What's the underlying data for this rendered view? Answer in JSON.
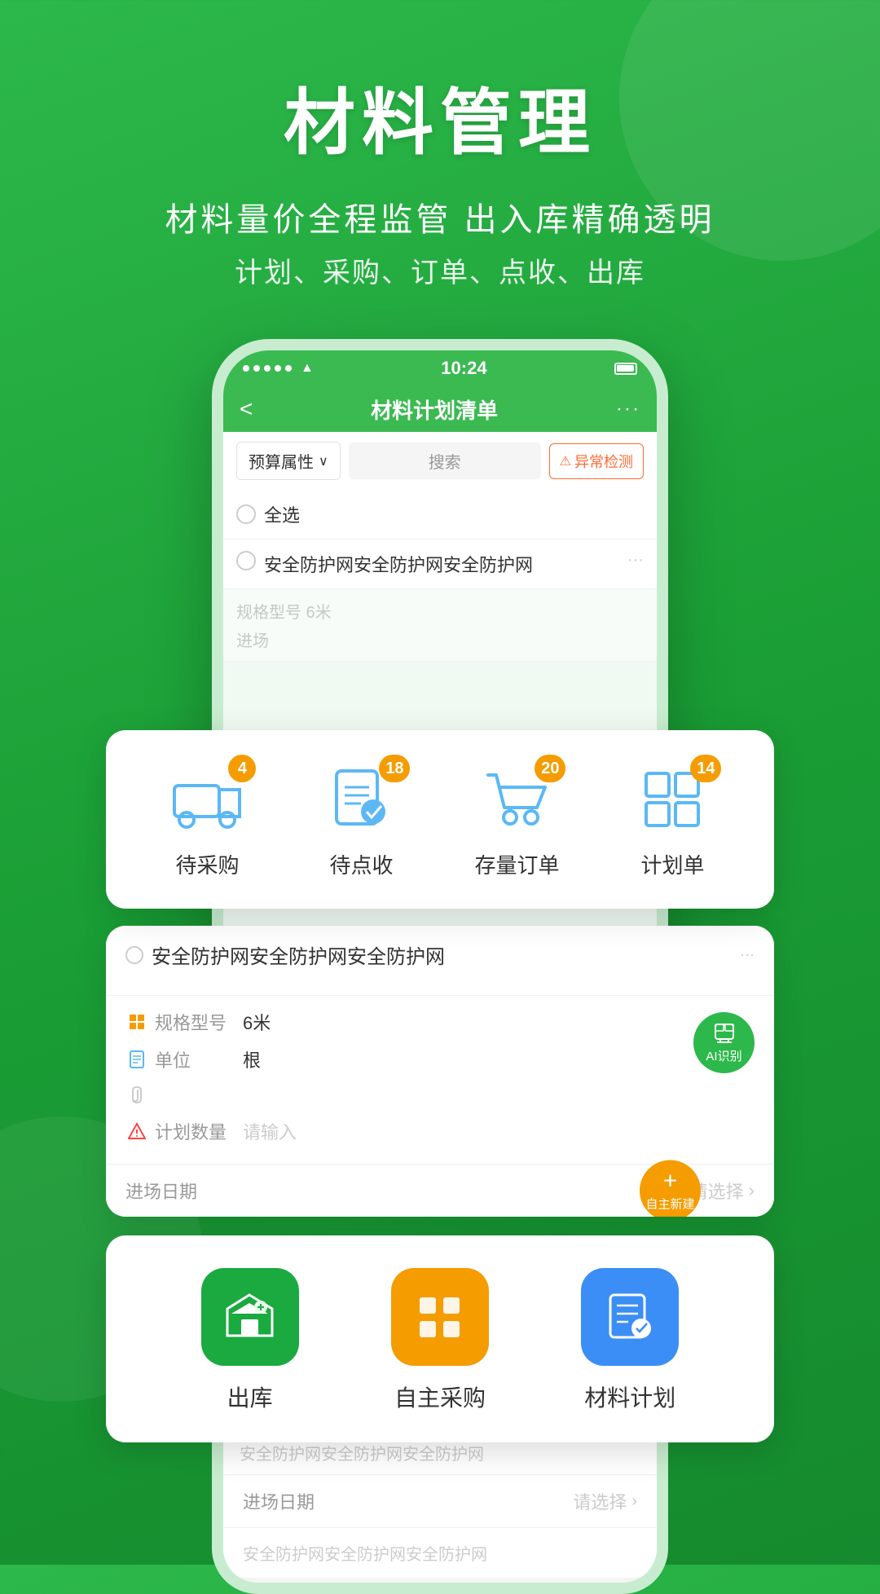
{
  "page": {
    "title": "材料管理",
    "subtitle1": "材料量价全程监管  出入库精确透明",
    "subtitle2": "计划、采购、订单、点收、出库"
  },
  "phone": {
    "status": {
      "time": "10:24",
      "wifi": "wifi",
      "battery": "battery"
    },
    "nav": {
      "back": "<",
      "title": "材料计划清单",
      "more": "···"
    },
    "filter": {
      "select_label": "预算属性",
      "search_placeholder": "搜索",
      "abnormal_label": "异常检测"
    },
    "list": {
      "select_all_label": "全选",
      "items": [
        {
          "name": "安全防护网安全防护网安全防护网"
        },
        {
          "name": "安全防护网安全防护网安全防护网"
        }
      ]
    },
    "detail_fields": [
      {
        "icon": "size-icon",
        "label": "规格型号",
        "value": "6米"
      },
      {
        "icon": "unit-icon",
        "label": "单位",
        "value": "根"
      },
      {
        "icon": "clip-icon",
        "label": "",
        "value": ""
      },
      {
        "icon": "warn-icon",
        "label": "计划数量",
        "placeholder": "请输入"
      }
    ],
    "date_row": {
      "label": "进场日期",
      "placeholder": "请选择"
    }
  },
  "quick_actions": [
    {
      "label": "待采购",
      "badge": "4"
    },
    {
      "label": "待点收",
      "badge": "18"
    },
    {
      "label": "存量订单",
      "badge": "20"
    },
    {
      "label": "计划单",
      "badge": "14"
    }
  ],
  "features": [
    {
      "label": "出库",
      "icon_type": "green"
    },
    {
      "label": "自主采购",
      "icon_type": "orange"
    },
    {
      "label": "材料计划",
      "icon_type": "blue"
    }
  ],
  "ai_btn": {
    "label": "AI识别"
  },
  "self_new_btn": {
    "label": "自主新建"
  },
  "colors": {
    "green": "#2db84b",
    "orange": "#f59c00",
    "blue": "#3b8ef5",
    "light_blue": "#5bb8f5"
  }
}
